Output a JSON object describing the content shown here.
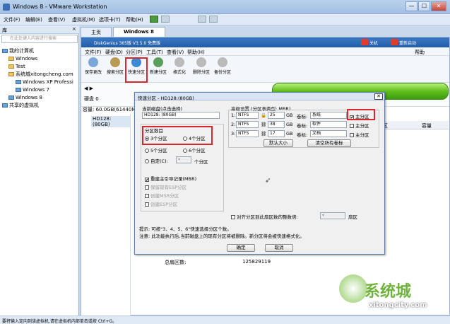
{
  "window": {
    "title": "Windows 8 - VMware Workstation",
    "min": "—",
    "max": "☐",
    "close": "✕"
  },
  "menu": [
    "文件(F)",
    "编辑(E)",
    "查看(V)",
    "虚拟机(M)",
    "选项卡(T)",
    "帮助(H)"
  ],
  "library": {
    "header": "库",
    "close": "×",
    "search_placeholder": "在此处键入内容进行搜索",
    "tree": [
      "我的计算机",
      "Windows",
      "Test",
      "系统城xitongcheng.com",
      "Windows XP Professi",
      "Windows 7",
      "Windows 8",
      "共享的虚拟机"
    ]
  },
  "tabs": [
    "主页",
    "Windows 8"
  ],
  "diskgenius": {
    "title": "DiskGenius 365版 V3.5.0 免费版",
    "upgrade": "关机",
    "reboot": "重新启动",
    "help": "帮助",
    "menu": [
      "文件(F)",
      "硬盘(D)",
      "分区(P)",
      "工具(T)",
      "查看(V)",
      "帮助(H)"
    ],
    "tools": [
      "保存更改",
      "搜索分区",
      "快速分区",
      "新建分区",
      "格式化",
      "删除分区",
      "备份分区"
    ],
    "disk_label": "硬盘 0",
    "capacity": "容量: 60.0GB(61440MB)",
    "tree_disk": "HD128: (80GB)",
    "col_sector": "扇区",
    "col_capacity": "容量",
    "bottom_label": "总扇区数:",
    "bottom_value": "125829119"
  },
  "dialog": {
    "title": "快速分区 - HD128:(80GB)",
    "close": "✕",
    "current_disk_label": "当前磁盘(点击选择)",
    "current_disk": "HD128: (80GB)",
    "count_label": "分区数目",
    "options": [
      "3个分区",
      "4个分区",
      "5个分区",
      "6个分区"
    ],
    "custom": "自定(C):",
    "custom_unit": "个分区",
    "mbr": "重建主引导记录(MBR)",
    "mbr_checked": "✔",
    "keep_existing": "保留现有ESP分区",
    "create_msr": "创建MSR分区",
    "create_esp": "创建ESP分区",
    "advanced_label": "高级设置 (分区表类型: MBR)",
    "rows": [
      {
        "n": "1:",
        "fs": "NTFS",
        "size": "25",
        "unit": "GB",
        "vlabel": "卷标:",
        "vol": "系统",
        "primary": "主分区",
        "checked": "✔"
      },
      {
        "n": "2:",
        "fs": "NTFS",
        "size": "38",
        "unit": "GB",
        "vlabel": "卷标:",
        "vol": "软件",
        "primary": "主分区",
        "checked": ""
      },
      {
        "n": "3:",
        "fs": "NTFS",
        "size": "17",
        "unit": "GB",
        "vlabel": "卷标:",
        "vol": "文档",
        "primary": "主分区",
        "checked": ""
      }
    ],
    "default_size": "默认大小",
    "clear_labels": "清空所有卷标",
    "align": "对齐分区到此扇区数的整数倍:",
    "align_unit": "扇区",
    "tip1": "提示: 可按\"3、4、5、6\"快速选择分区个数。",
    "tip2": "注意: 此功能执行后,当前磁盘上的现有分区将被删除。新分区将会被快速格式化。",
    "ok": "确定",
    "cancel": "取消"
  },
  "status": "要将输入定向到该虚拟机,请在虚拟机内部单击或按 Ctrl+G。",
  "watermark": {
    "main": "系统城",
    "sub": "xitongcity.com"
  },
  "colors": {
    "highlight": "#d8262b",
    "green": "#5fbe1d"
  }
}
